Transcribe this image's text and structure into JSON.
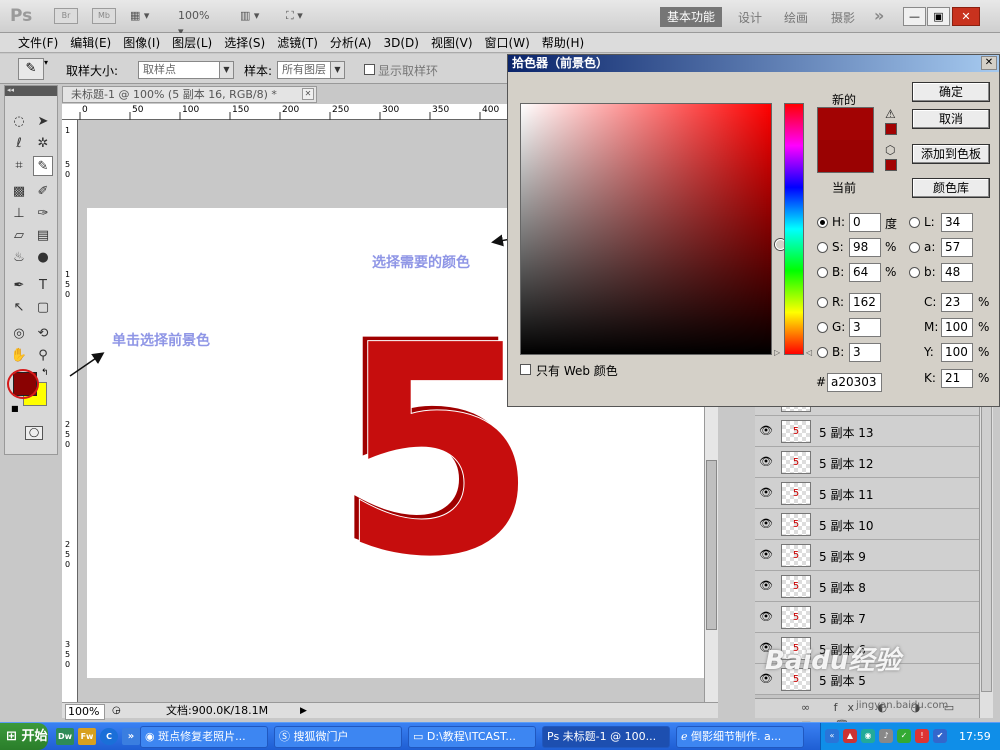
{
  "appbar": {
    "logo": "Ps",
    "br": "Br",
    "mb": "Mb",
    "zoom": "100%",
    "workspaces": [
      "基本功能",
      "设计",
      "绘画",
      "摄影"
    ],
    "more": "»",
    "win_minimize": "—",
    "win_restore": "▣",
    "win_close": "✕"
  },
  "menubar": [
    "文件(F)",
    "编辑(E)",
    "图像(I)",
    "图层(L)",
    "选择(S)",
    "滤镜(T)",
    "分析(A)",
    "3D(D)",
    "视图(V)",
    "窗口(W)",
    "帮助(H)"
  ],
  "options": {
    "sample_size_label": "取样大小:",
    "sample_size_value": "取样点",
    "sample_label": "样本:",
    "sample_value": "所有图层",
    "show_ring": "显示取样环"
  },
  "document": {
    "tab_title": "未标题-1 @ 100% (5 副本 16, RGB/8) *",
    "close": "✕",
    "ruler_top": [
      "0",
      "50",
      "100",
      "150",
      "200",
      "250",
      "300",
      "350",
      "400"
    ],
    "ruler_left": [
      "1",
      "5",
      "0",
      "1",
      "5",
      "0",
      "2",
      "5",
      "0",
      "2",
      "5",
      "0",
      "3",
      "5",
      "0"
    ],
    "digit": "5",
    "status_zoom": "100%",
    "status_doc": "文档:900.0K/18.1M"
  },
  "annotations": {
    "pick_color": "选择需要的颜色",
    "click_fg": "单击选择前景色"
  },
  "picker": {
    "title": "拾色器（前景色）",
    "new_label": "新的",
    "current_label": "当前",
    "ok": "确定",
    "cancel": "取消",
    "add_swatch": "添加到色板",
    "libraries": "颜色库",
    "web_only": "只有 Web 颜色",
    "h": {
      "label": "H:",
      "value": "0",
      "unit": "度"
    },
    "s": {
      "label": "S:",
      "value": "98",
      "unit": "%"
    },
    "b": {
      "label": "B:",
      "value": "64",
      "unit": "%"
    },
    "r": {
      "label": "R:",
      "value": "162"
    },
    "g": {
      "label": "G:",
      "value": "3"
    },
    "bl": {
      "label": "B:",
      "value": "3"
    },
    "lab_l": {
      "label": "L:",
      "value": "34"
    },
    "lab_a": {
      "label": "a:",
      "value": "57"
    },
    "lab_b": {
      "label": "b:",
      "value": "48"
    },
    "c": {
      "label": "C:",
      "value": "23",
      "unit": "%"
    },
    "m": {
      "label": "M:",
      "value": "100",
      "unit": "%"
    },
    "y": {
      "label": "Y:",
      "value": "100",
      "unit": "%"
    },
    "k": {
      "label": "K:",
      "value": "21",
      "unit": "%"
    },
    "hash": "#",
    "hex": "a20303",
    "new_color": "#a20303",
    "current_color": "#9a0202"
  },
  "layers": [
    {
      "name": "5 副本 13"
    },
    {
      "name": "5 副本 12"
    },
    {
      "name": "5 副本 11"
    },
    {
      "name": "5 副本 10"
    },
    {
      "name": "5 副本 9"
    },
    {
      "name": "5 副本 8"
    },
    {
      "name": "5 副本 7"
    },
    {
      "name": "5 副本 6"
    },
    {
      "name": "5 副本 5"
    }
  ],
  "layer_footer": "∞ fx ◐ ◑ ▭ ▤ 🗑",
  "taskbar": {
    "start": "开始",
    "tasks": [
      "斑点修复老照片...",
      "搜狐微门户",
      "D:\\教程\\ITCAST...",
      "未标题-1 @ 100...",
      "倒影细节制作. a..."
    ],
    "clock": "17:59"
  },
  "watermark": "Baidu经验",
  "watermark_url": "jingyan.baidu.com"
}
